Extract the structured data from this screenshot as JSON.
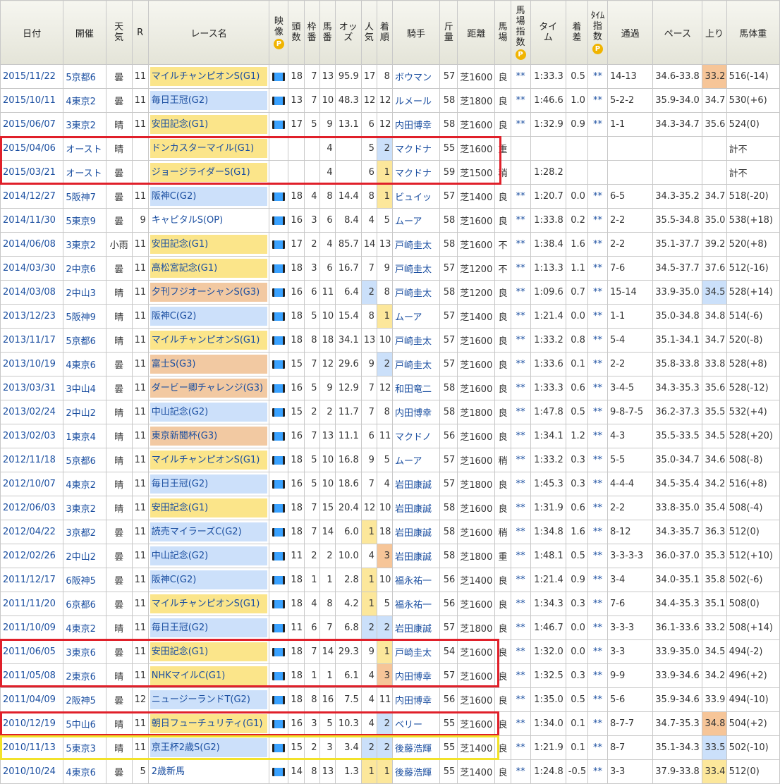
{
  "headers": [
    "日付",
    "開催",
    "天気",
    "R",
    "レース名",
    "映像",
    "頭数",
    "枠番",
    "馬番",
    "オッズ",
    "人気",
    "着順",
    "騎手",
    "斤量",
    "距離",
    "馬場",
    "馬場指数",
    "タイム",
    "着差",
    "タイム指数",
    "通過",
    "ペース",
    "上り",
    "馬体重"
  ],
  "ptag": "P",
  "rows": [
    {
      "date": "2015/11/22",
      "venue": "5京都6",
      "weather": "曇",
      "r": "11",
      "race": "マイルチャンピオンS(G1)",
      "grade": "g1",
      "video": true,
      "field": "18",
      "waku": "7",
      "uma": "13",
      "odds": "95.9",
      "pop": "17",
      "finish": "8",
      "jockey": "ボウマン",
      "kinryo": "57",
      "dist": "芝1600",
      "baba": "良",
      "bsi": "**",
      "time": "1:33.3",
      "diff": "0.5",
      "ti": "**",
      "pass": "14-13",
      "pace": "34.6-33.8",
      "agari": "33.2",
      "agari_hl": "orange",
      "weight": "516(-14)"
    },
    {
      "date": "2015/10/11",
      "venue": "4東京2",
      "weather": "曇",
      "r": "11",
      "race": "毎日王冠(G2)",
      "grade": "g2",
      "video": true,
      "field": "13",
      "waku": "7",
      "uma": "10",
      "odds": "48.3",
      "pop": "12",
      "finish": "12",
      "jockey": "ルメール",
      "kinryo": "58",
      "dist": "芝1800",
      "baba": "良",
      "bsi": "**",
      "time": "1:46.6",
      "diff": "1.0",
      "ti": "**",
      "pass": "5-2-2",
      "pace": "35.9-34.0",
      "agari": "34.7",
      "weight": "530(+6)"
    },
    {
      "date": "2015/06/07",
      "venue": "3東京2",
      "weather": "晴",
      "r": "11",
      "race": "安田記念(G1)",
      "grade": "g1",
      "video": true,
      "field": "17",
      "waku": "5",
      "uma": "9",
      "odds": "13.1",
      "pop": "6",
      "finish": "12",
      "jockey": "内田博幸",
      "kinryo": "58",
      "dist": "芝1600",
      "baba": "良",
      "bsi": "**",
      "time": "1:32.9",
      "diff": "0.9",
      "ti": "**",
      "pass": "1-1",
      "pace": "34.3-34.7",
      "agari": "35.6",
      "weight": "524(0)"
    },
    {
      "date": "2015/04/06",
      "venue": "オースト",
      "weather": "晴",
      "r": "",
      "race": "ドンカスターマイル(G1)",
      "grade": "g1",
      "video": false,
      "field": "",
      "waku": "",
      "uma": "4",
      "odds": "",
      "pop": "5",
      "finish": "2",
      "finish_hl": "blue",
      "jockey": "マクドナ",
      "kinryo": "55",
      "dist": "芝1600",
      "baba": "重",
      "bsi": "",
      "time": "",
      "diff": "",
      "ti": "",
      "pass": "",
      "pace": "",
      "agari": "",
      "weight": "計不"
    },
    {
      "date": "2015/03/21",
      "venue": "オースト",
      "weather": "曇",
      "r": "",
      "race": "ジョージライダーS(G1)",
      "grade": "g1",
      "video": false,
      "field": "",
      "waku": "",
      "uma": "4",
      "odds": "",
      "pop": "6",
      "finish": "1",
      "finish_hl": "yellow",
      "jockey": "マクドナ",
      "kinryo": "59",
      "dist": "芝1500",
      "baba": "稍",
      "bsi": "",
      "time": "1:28.2",
      "diff": "",
      "ti": "",
      "pass": "",
      "pace": "",
      "agari": "",
      "weight": "計不"
    },
    {
      "date": "2014/12/27",
      "venue": "5阪神7",
      "weather": "曇",
      "r": "11",
      "race": "阪神C(G2)",
      "grade": "g2",
      "video": true,
      "field": "18",
      "waku": "4",
      "uma": "8",
      "odds": "14.4",
      "pop": "8",
      "finish": "1",
      "finish_hl": "yellow",
      "jockey": "ビュイッ",
      "kinryo": "57",
      "dist": "芝1400",
      "baba": "良",
      "bsi": "**",
      "time": "1:20.7",
      "diff": "0.0",
      "ti": "**",
      "pass": "6-5",
      "pace": "34.3-35.2",
      "agari": "34.7",
      "weight": "518(-20)"
    },
    {
      "date": "2014/11/30",
      "venue": "5東京9",
      "weather": "曇",
      "r": "9",
      "race": "キャピタルS(OP)",
      "grade": "op",
      "video": true,
      "field": "16",
      "waku": "3",
      "uma": "6",
      "odds": "8.4",
      "pop": "4",
      "finish": "5",
      "jockey": "ムーア",
      "kinryo": "58",
      "dist": "芝1600",
      "baba": "良",
      "bsi": "**",
      "time": "1:33.8",
      "diff": "0.2",
      "ti": "**",
      "pass": "2-2",
      "pace": "35.5-34.8",
      "agari": "35.0",
      "weight": "538(+18)"
    },
    {
      "date": "2014/06/08",
      "venue": "3東京2",
      "weather": "小雨",
      "r": "11",
      "race": "安田記念(G1)",
      "grade": "g1",
      "video": true,
      "field": "17",
      "waku": "2",
      "uma": "4",
      "odds": "85.7",
      "pop": "14",
      "finish": "13",
      "jockey": "戸崎圭太",
      "kinryo": "58",
      "dist": "芝1600",
      "baba": "不",
      "bsi": "**",
      "time": "1:38.4",
      "diff": "1.6",
      "ti": "**",
      "pass": "2-2",
      "pace": "35.1-37.7",
      "agari": "39.2",
      "weight": "520(+8)"
    },
    {
      "date": "2014/03/30",
      "venue": "2中京6",
      "weather": "曇",
      "r": "11",
      "race": "高松宮記念(G1)",
      "grade": "g1",
      "video": true,
      "field": "18",
      "waku": "3",
      "uma": "6",
      "odds": "16.7",
      "pop": "7",
      "finish": "9",
      "jockey": "戸崎圭太",
      "kinryo": "57",
      "dist": "芝1200",
      "baba": "不",
      "bsi": "**",
      "time": "1:13.3",
      "diff": "1.1",
      "ti": "**",
      "pass": "7-6",
      "pace": "34.5-37.7",
      "agari": "37.6",
      "weight": "512(-16)"
    },
    {
      "date": "2014/03/08",
      "venue": "2中山3",
      "weather": "晴",
      "r": "11",
      "race": "夕刊フジオーシャンS(G3)",
      "grade": "g3",
      "video": true,
      "field": "16",
      "waku": "6",
      "uma": "11",
      "odds": "6.4",
      "pop": "2",
      "pop_hl": "blue",
      "finish": "8",
      "jockey": "戸崎圭太",
      "kinryo": "58",
      "dist": "芝1200",
      "baba": "良",
      "bsi": "**",
      "time": "1:09.6",
      "diff": "0.7",
      "ti": "**",
      "pass": "15-14",
      "pace": "33.9-35.0",
      "agari": "34.5",
      "agari_hl": "blue",
      "weight": "528(+14)"
    },
    {
      "date": "2013/12/23",
      "venue": "5阪神9",
      "weather": "晴",
      "r": "11",
      "race": "阪神C(G2)",
      "grade": "g2",
      "video": true,
      "field": "18",
      "waku": "5",
      "uma": "10",
      "odds": "15.4",
      "pop": "8",
      "finish": "1",
      "finish_hl": "yellow",
      "jockey": "ムーア",
      "kinryo": "57",
      "dist": "芝1400",
      "baba": "良",
      "bsi": "**",
      "time": "1:21.4",
      "diff": "0.0",
      "ti": "**",
      "pass": "1-1",
      "pace": "35.0-34.8",
      "agari": "34.8",
      "weight": "514(-6)"
    },
    {
      "date": "2013/11/17",
      "venue": "5京都6",
      "weather": "晴",
      "r": "11",
      "race": "マイルチャンピオンS(G1)",
      "grade": "g1",
      "video": true,
      "field": "18",
      "waku": "8",
      "uma": "18",
      "odds": "34.1",
      "pop": "13",
      "finish": "10",
      "jockey": "戸崎圭太",
      "kinryo": "57",
      "dist": "芝1600",
      "baba": "良",
      "bsi": "**",
      "time": "1:33.2",
      "diff": "0.8",
      "ti": "**",
      "pass": "5-4",
      "pace": "35.1-34.1",
      "agari": "34.7",
      "weight": "520(-8)"
    },
    {
      "date": "2013/10/19",
      "venue": "4東京6",
      "weather": "曇",
      "r": "11",
      "race": "富士S(G3)",
      "grade": "g3",
      "video": true,
      "field": "15",
      "waku": "7",
      "uma": "12",
      "odds": "29.6",
      "pop": "9",
      "finish": "2",
      "finish_hl": "blue",
      "jockey": "戸崎圭太",
      "kinryo": "57",
      "dist": "芝1600",
      "baba": "良",
      "bsi": "**",
      "time": "1:33.6",
      "diff": "0.1",
      "ti": "**",
      "pass": "2-2",
      "pace": "35.8-33.8",
      "agari": "33.8",
      "weight": "528(+8)"
    },
    {
      "date": "2013/03/31",
      "venue": "3中山4",
      "weather": "曇",
      "r": "11",
      "race": "ダービー卿チャレンジ(G3)",
      "grade": "g3",
      "video": true,
      "field": "16",
      "waku": "5",
      "uma": "9",
      "odds": "12.9",
      "pop": "7",
      "finish": "12",
      "jockey": "和田竜二",
      "kinryo": "58",
      "dist": "芝1600",
      "baba": "良",
      "bsi": "**",
      "time": "1:33.3",
      "diff": "0.6",
      "ti": "**",
      "pass": "3-4-5",
      "pace": "34.3-35.3",
      "agari": "35.6",
      "weight": "528(-12)"
    },
    {
      "date": "2013/02/24",
      "venue": "2中山2",
      "weather": "晴",
      "r": "11",
      "race": "中山記念(G2)",
      "grade": "g2",
      "video": true,
      "field": "15",
      "waku": "2",
      "uma": "2",
      "odds": "11.7",
      "pop": "7",
      "finish": "8",
      "jockey": "内田博幸",
      "kinryo": "58",
      "dist": "芝1800",
      "baba": "良",
      "bsi": "**",
      "time": "1:47.8",
      "diff": "0.5",
      "ti": "**",
      "pass": "9-8-7-5",
      "pace": "36.2-37.3",
      "agari": "35.5",
      "weight": "532(+4)"
    },
    {
      "date": "2013/02/03",
      "venue": "1東京4",
      "weather": "晴",
      "r": "11",
      "race": "東京新聞杯(G3)",
      "grade": "g3",
      "video": true,
      "field": "16",
      "waku": "7",
      "uma": "13",
      "odds": "11.1",
      "pop": "6",
      "finish": "11",
      "jockey": "マクドノ",
      "kinryo": "56",
      "dist": "芝1600",
      "baba": "良",
      "bsi": "**",
      "time": "1:34.1",
      "diff": "1.2",
      "ti": "**",
      "pass": "4-3",
      "pace": "35.5-33.5",
      "agari": "34.5",
      "weight": "528(+20)"
    },
    {
      "date": "2012/11/18",
      "venue": "5京都6",
      "weather": "晴",
      "r": "11",
      "race": "マイルチャンピオンS(G1)",
      "grade": "g1",
      "video": true,
      "field": "18",
      "waku": "5",
      "uma": "10",
      "odds": "16.8",
      "pop": "9",
      "finish": "5",
      "jockey": "ムーア",
      "kinryo": "57",
      "dist": "芝1600",
      "baba": "稍",
      "bsi": "**",
      "time": "1:33.2",
      "diff": "0.3",
      "ti": "**",
      "pass": "5-5",
      "pace": "35.0-34.7",
      "agari": "34.6",
      "weight": "508(-8)"
    },
    {
      "date": "2012/10/07",
      "venue": "4東京2",
      "weather": "晴",
      "r": "11",
      "race": "毎日王冠(G2)",
      "grade": "g2",
      "video": true,
      "field": "16",
      "waku": "5",
      "uma": "10",
      "odds": "18.6",
      "pop": "7",
      "finish": "4",
      "jockey": "岩田康誠",
      "kinryo": "57",
      "dist": "芝1800",
      "baba": "良",
      "bsi": "**",
      "time": "1:45.3",
      "diff": "0.3",
      "ti": "**",
      "pass": "4-4-4",
      "pace": "34.5-35.4",
      "agari": "34.2",
      "weight": "516(+8)"
    },
    {
      "date": "2012/06/03",
      "venue": "3東京2",
      "weather": "晴",
      "r": "11",
      "race": "安田記念(G1)",
      "grade": "g1",
      "video": true,
      "field": "18",
      "waku": "7",
      "uma": "15",
      "odds": "20.4",
      "pop": "12",
      "finish": "10",
      "jockey": "岩田康誠",
      "kinryo": "58",
      "dist": "芝1600",
      "baba": "良",
      "bsi": "**",
      "time": "1:31.9",
      "diff": "0.6",
      "ti": "**",
      "pass": "2-2",
      "pace": "33.8-35.0",
      "agari": "35.4",
      "weight": "508(-4)"
    },
    {
      "date": "2012/04/22",
      "venue": "3京都2",
      "weather": "曇",
      "r": "11",
      "race": "読売マイラーズC(G2)",
      "grade": "g2",
      "video": true,
      "field": "18",
      "waku": "7",
      "uma": "14",
      "odds": "6.0",
      "pop": "1",
      "pop_hl": "yellow",
      "finish": "18",
      "jockey": "岩田康誠",
      "kinryo": "58",
      "dist": "芝1600",
      "baba": "稍",
      "bsi": "**",
      "time": "1:34.8",
      "diff": "1.6",
      "ti": "**",
      "pass": "8-12",
      "pace": "34.3-35.7",
      "agari": "36.3",
      "weight": "512(0)"
    },
    {
      "date": "2012/02/26",
      "venue": "2中山2",
      "weather": "曇",
      "r": "11",
      "race": "中山記念(G2)",
      "grade": "g2",
      "video": true,
      "field": "11",
      "waku": "2",
      "uma": "2",
      "odds": "10.0",
      "pop": "4",
      "finish": "3",
      "finish_hl": "orange",
      "jockey": "岩田康誠",
      "kinryo": "58",
      "dist": "芝1800",
      "baba": "重",
      "bsi": "**",
      "time": "1:48.1",
      "diff": "0.5",
      "ti": "**",
      "pass": "3-3-3-3",
      "pace": "36.0-37.0",
      "agari": "35.3",
      "weight": "512(+10)"
    },
    {
      "date": "2011/12/17",
      "venue": "6阪神5",
      "weather": "曇",
      "r": "11",
      "race": "阪神C(G2)",
      "grade": "g2",
      "video": true,
      "field": "18",
      "waku": "1",
      "uma": "1",
      "odds": "2.8",
      "pop": "1",
      "pop_hl": "yellow",
      "finish": "10",
      "jockey": "福永祐一",
      "kinryo": "56",
      "dist": "芝1400",
      "baba": "良",
      "bsi": "**",
      "time": "1:21.4",
      "diff": "0.9",
      "ti": "**",
      "pass": "3-4",
      "pace": "34.0-35.1",
      "agari": "35.8",
      "weight": "502(-6)"
    },
    {
      "date": "2011/11/20",
      "venue": "6京都6",
      "weather": "曇",
      "r": "11",
      "race": "マイルチャンピオンS(G1)",
      "grade": "g1",
      "video": true,
      "field": "18",
      "waku": "4",
      "uma": "8",
      "odds": "4.2",
      "pop": "1",
      "pop_hl": "yellow",
      "finish": "5",
      "jockey": "福永祐一",
      "kinryo": "56",
      "dist": "芝1600",
      "baba": "良",
      "bsi": "**",
      "time": "1:34.3",
      "diff": "0.3",
      "ti": "**",
      "pass": "7-6",
      "pace": "34.4-35.3",
      "agari": "35.1",
      "weight": "508(0)"
    },
    {
      "date": "2011/10/09",
      "venue": "4東京2",
      "weather": "晴",
      "r": "11",
      "race": "毎日王冠(G2)",
      "grade": "g2",
      "video": true,
      "field": "11",
      "waku": "6",
      "uma": "7",
      "odds": "6.8",
      "pop": "2",
      "pop_hl": "blue",
      "finish": "2",
      "finish_hl": "blue",
      "jockey": "岩田康誠",
      "kinryo": "57",
      "dist": "芝1800",
      "baba": "良",
      "bsi": "**",
      "time": "1:46.7",
      "diff": "0.0",
      "ti": "**",
      "pass": "3-3-3",
      "pace": "36.1-33.6",
      "agari": "33.2",
      "weight": "508(+14)"
    },
    {
      "date": "2011/06/05",
      "venue": "3東京6",
      "weather": "曇",
      "r": "11",
      "race": "安田記念(G1)",
      "grade": "g1",
      "video": true,
      "field": "18",
      "waku": "7",
      "uma": "14",
      "odds": "29.3",
      "pop": "9",
      "finish": "1",
      "finish_hl": "yellow",
      "jockey": "戸崎圭太",
      "kinryo": "54",
      "dist": "芝1600",
      "baba": "良",
      "bsi": "**",
      "time": "1:32.0",
      "diff": "0.0",
      "ti": "**",
      "pass": "3-3",
      "pace": "33.9-35.0",
      "agari": "34.5",
      "weight": "494(-2)"
    },
    {
      "date": "2011/05/08",
      "venue": "2東京6",
      "weather": "晴",
      "r": "11",
      "race": "NHKマイルC(G1)",
      "grade": "g1",
      "video": true,
      "field": "18",
      "waku": "1",
      "uma": "1",
      "odds": "6.1",
      "pop": "4",
      "finish": "3",
      "finish_hl": "orange",
      "jockey": "内田博幸",
      "kinryo": "57",
      "dist": "芝1600",
      "baba": "良",
      "bsi": "**",
      "time": "1:32.5",
      "diff": "0.3",
      "ti": "**",
      "pass": "9-9",
      "pace": "33.9-34.6",
      "agari": "34.2",
      "weight": "496(+2)"
    },
    {
      "date": "2011/04/09",
      "venue": "2阪神5",
      "weather": "曇",
      "r": "12",
      "race": "ニュージーランドT(G2)",
      "grade": "g2",
      "video": true,
      "field": "18",
      "waku": "8",
      "uma": "16",
      "odds": "7.5",
      "pop": "4",
      "finish": "11",
      "jockey": "内田博幸",
      "kinryo": "56",
      "dist": "芝1600",
      "baba": "良",
      "bsi": "**",
      "time": "1:35.0",
      "diff": "0.5",
      "ti": "**",
      "pass": "5-6",
      "pace": "35.9-34.6",
      "agari": "33.9",
      "weight": "494(-10)"
    },
    {
      "date": "2010/12/19",
      "venue": "5中山6",
      "weather": "晴",
      "r": "11",
      "race": "朝日フューチュリティ(G1)",
      "grade": "g1",
      "video": true,
      "field": "16",
      "waku": "3",
      "uma": "5",
      "odds": "10.3",
      "pop": "4",
      "finish": "2",
      "finish_hl": "blue",
      "jockey": "ベリー",
      "kinryo": "55",
      "dist": "芝1600",
      "baba": "良",
      "bsi": "**",
      "time": "1:34.0",
      "diff": "0.1",
      "ti": "**",
      "pass": "8-7-7",
      "pace": "34.7-35.3",
      "agari": "34.8",
      "agari_hl": "orange",
      "weight": "504(+2)"
    },
    {
      "date": "2010/11/13",
      "venue": "5東京3",
      "weather": "晴",
      "r": "11",
      "race": "京王杯2歳S(G2)",
      "grade": "g2",
      "video": true,
      "field": "15",
      "waku": "2",
      "uma": "3",
      "odds": "3.4",
      "pop": "2",
      "pop_hl": "blue",
      "finish": "2",
      "finish_hl": "blue",
      "jockey": "後藤浩輝",
      "kinryo": "55",
      "dist": "芝1400",
      "baba": "良",
      "bsi": "**",
      "time": "1:21.9",
      "diff": "0.1",
      "ti": "**",
      "pass": "8-7",
      "pace": "35.1-34.3",
      "agari": "33.5",
      "agari_hl": "blue",
      "weight": "502(-10)"
    },
    {
      "date": "2010/10/24",
      "venue": "4東京6",
      "weather": "曇",
      "r": "5",
      "race": "2歳新馬",
      "grade": "op",
      "video": true,
      "field": "14",
      "waku": "8",
      "uma": "13",
      "odds": "1.3",
      "pop": "1",
      "pop_hl": "yellow",
      "finish": "1",
      "finish_hl": "yellow",
      "jockey": "後藤浩輝",
      "kinryo": "55",
      "dist": "芝1400",
      "baba": "良",
      "bsi": "**",
      "time": "1:24.8",
      "diff": "-0.5",
      "ti": "**",
      "pass": "3-3",
      "pace": "37.9-33.8",
      "agari": "33.4",
      "agari_hl": "yellow",
      "weight": "512(0)"
    }
  ]
}
